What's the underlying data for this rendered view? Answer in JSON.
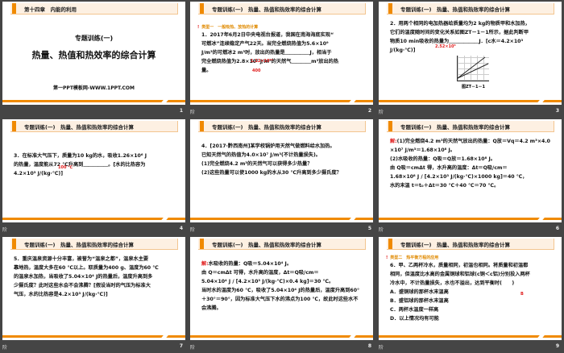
{
  "header_title": "专题训练(一)　热量、热值和热效率的综合计算",
  "slides": [
    {
      "number": "1",
      "header": "第十四章　内能的利用",
      "title_small": "专题训练(一)",
      "title_big": "热量、热值和热效率的综合计算",
      "site": "第一PPT模板网-WWW.1PPT.COM",
      "footer_icon": ""
    },
    {
      "number": "2",
      "footer_icon": "阶",
      "section": "类型一　一般吸热、放热的计算",
      "lines": [
        "1．2017年6月2日中央电视台报道，我国在南海海底实现“",
        "可燃冰”连续稳定产气22天。当完全燃烧热值为5.6×10⁹",
        "J/m³的可燃冰2 m³时，放出的热量是＿＿＿＿＿J，相当于",
        "完全燃烧热值为2.8×10⁷ J/m³的天然气＿＿＿＿m³放出的热",
        "量。"
      ],
      "answers": [
        "1.12×10¹⁰",
        "400"
      ]
    },
    {
      "number": "3",
      "footer_icon": "阶",
      "lines": [
        "2．用两个相同的电加热器给质量均为2 kg的物质甲和水加热，",
        "它们的温度随时间的变化关系如图ZT－1－1所示，据此判断甲",
        "物质10 min吸收的热量为＿＿＿＿＿＿J．[c水＝4.2×10³",
        "J/(kg·℃)]"
      ],
      "answers": [
        "2.52×10⁵"
      ],
      "figure_caption": "图ZT－1－1"
    },
    {
      "number": "4",
      "footer_icon": "阶",
      "lines": [
        "3．在标准大气压下，质量为10 kg的水，吸收1.26×10⁶ J",
        "的热量，温度能从72 ℃升高到＿＿＿＿＿。[水的比热容为",
        "4.2×10³ J/(kg·℃)]"
      ],
      "answers": [
        "100 ℃"
      ]
    },
    {
      "number": "5",
      "footer_icon": "阶",
      "lines": [
        "4．[2017·黔西南州]某学校锅炉用天然气做燃料给水加热。",
        "已知天然气的热值为4.0×10⁷ J/m³(不计热量损失)。",
        "(1)完全燃烧4.2 m³的天然气可以获得多少热量？",
        "(2)这些热量可以使1000 kg的水从30 ℃升高到多少摄氏度？"
      ]
    },
    {
      "number": "6",
      "footer_icon": "阶",
      "answer_label": "解:",
      "lines": [
        "(1)完全燃烧4.2 m³的天然气放出的热量：Q放＝Vq＝4.2 m³×4.0",
        "×10⁷ J/m³＝1.68×10⁸ J。",
        "(2)水吸收的热量：Q吸＝Q放＝1.68×10⁸ J。",
        "由 Q吸＝cmΔt 得，水升高的温度：Δt＝Q吸/cm＝",
        "1.68×10⁸ J / [4.2×10³ J/(kg·℃)×1000 kg]＝40 ℃，",
        "水的末温 t＝t₀＋Δt＝30 ℃＋40 ℃＝70 ℃。"
      ]
    },
    {
      "number": "7",
      "footer_icon": "阶",
      "lines": [
        "5．重庆温泉资源十分丰富，被誉为“温泉之都”，温泉水主要",
        "靠地热，温度大多在60 ℃以上。取质量为400 g、温度为60 ℃",
        "的温泉水加热，当吸收了5.04×10⁴ J的热量后，温度升高到多",
        "少摄氏度？此时这些水会不会沸腾？[假设当时的气压为标准大",
        "气压，水的比热容是4.2×10³ J/(kg·℃)]"
      ]
    },
    {
      "number": "8",
      "footer_icon": "阶",
      "answer_label": "解:",
      "lines": [
        "水吸收的热量：Q吸＝5.04×10⁴ J。",
        "由 Q＝cmΔt 可得，水升高的温度，Δt＝Q吸/cm＝",
        "5.04×10⁴ J / [4.2×10³ J/(kg·℃)×0.4 kg]＝30 ℃。",
        "当时水的温度为60 ℃，吸收了5.04×10⁴ J的热量后，温度升高到60°",
        "＋30°＝90°，因为标准大气压下水的沸点为100 ℃，故此时这些水不",
        "会沸腾。"
      ]
    },
    {
      "number": "9",
      "footer_icon": "阶",
      "section": "类型二　热平衡方程的应用",
      "lines": [
        "6．甲、乙两杯冷水，质量相同，初温也相同。将质量和初温都",
        "相同，但温度比水高的金属铜球和铝球(c铜＜c铝)分别投入两杯",
        "冷水中，不计热量损失，水也不溢出，达到平衡时(　　)",
        "A．盛铜球的那杯水末温高",
        "B．盛铝球的那杯水末温高",
        "C．两杯水温度一样高",
        "D．以上情况均有可能"
      ],
      "answers": [
        "B"
      ]
    }
  ]
}
